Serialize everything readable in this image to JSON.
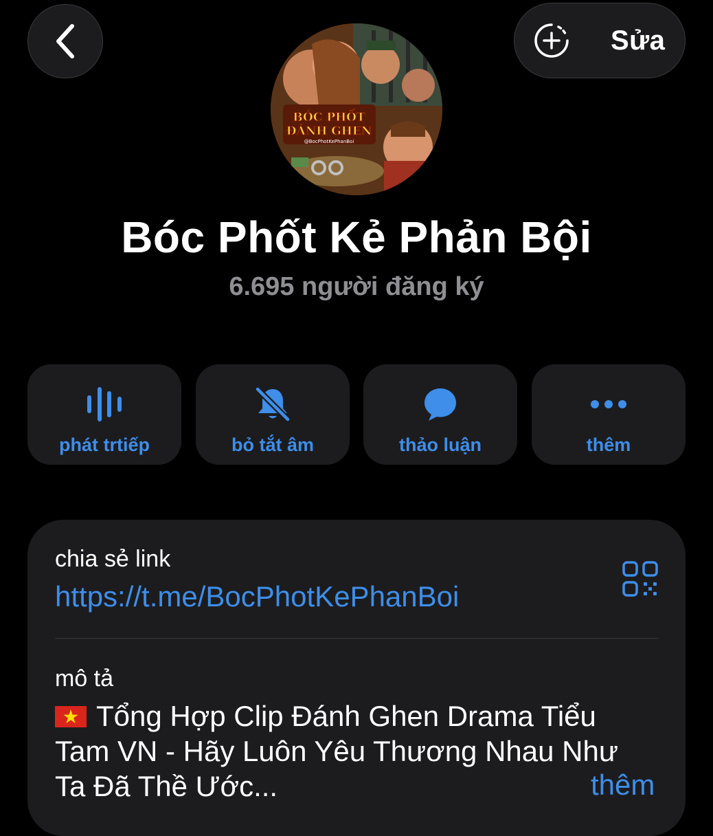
{
  "header": {
    "back_icon": "chevron-left-icon",
    "add_story_icon": "add-story-icon",
    "edit_label": "Sửa"
  },
  "profile": {
    "avatar_text_line1": "BÓC PHỐT",
    "avatar_text_line2": "ĐÁNH GHEN",
    "avatar_handle": "@BocPhotKePhanBoi",
    "name": "Bóc Phốt Kẻ Phản Bội",
    "subscribers": "6.695 người đăng ký"
  },
  "actions": [
    {
      "icon": "live-stream-icon",
      "label": "phát trtiếp"
    },
    {
      "icon": "bell-muted-icon",
      "label": "bỏ tắt âm"
    },
    {
      "icon": "chat-bubble-icon",
      "label": "thảo luận"
    },
    {
      "icon": "more-dots-icon",
      "label": "thêm"
    }
  ],
  "info": {
    "share_label": "chia sẻ link",
    "share_link": "https://t.me/BocPhotKePhanBoi",
    "qr_icon": "qr-code-icon",
    "desc_label": "mô tả",
    "description": "Tổng Hợp Clip Đánh Ghen Drama Tiểu Tam VN - Hãy Luôn Yêu Thương Nhau Như Ta Đã Thề Ước...",
    "more_label": "thêm"
  },
  "colors": {
    "background": "#000000",
    "card": "#1c1c1e",
    "accent": "#3e8eea",
    "secondary_text": "#8e8e93",
    "flag_red": "#da251d",
    "flag_star": "#ffde00"
  }
}
